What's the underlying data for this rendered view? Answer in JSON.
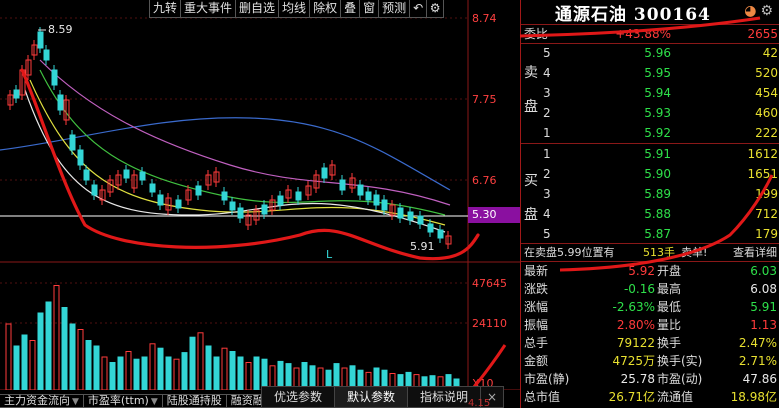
{
  "toolbar": {
    "items": [
      "九转",
      "重大事件",
      "删自选",
      "均线",
      "除权",
      "叠",
      "窗",
      "预测"
    ],
    "back_icon": "back-arrow-icon",
    "settings_icon": "gear-icon"
  },
  "chart": {
    "price_axis": [
      "8.74",
      "7.75",
      "6.76",
      "5.30"
    ],
    "volume_axis": [
      "47645",
      "24110",
      "X10"
    ],
    "high_label": "8.59",
    "low_label": "5.91",
    "low_marker": "L",
    "bottom_price": "4.15"
  },
  "bottom_tabs": [
    {
      "label": "主力资金流向",
      "arrow": "▼"
    },
    {
      "label": "市盈率(ttm)",
      "arrow": "▼"
    },
    {
      "label": "陆股通持股",
      "arrow": ""
    },
    {
      "label": "融资融券余额",
      "arrow": "▼"
    }
  ],
  "footer": {
    "tab_optimize": "优选参数",
    "tab_default": "默认参数",
    "tab_explain": "指标说明",
    "close": "×"
  },
  "quote": {
    "title": "通源石油 300164",
    "committee": {
      "label": "委比",
      "value": "+43.88%",
      "diff": "2655"
    },
    "sell_label": [
      "卖",
      "盘"
    ],
    "buy_label": [
      "买",
      "盘"
    ],
    "sell": [
      {
        "level": "5",
        "price": "5.96",
        "vol": "42"
      },
      {
        "level": "4",
        "price": "5.95",
        "vol": "520"
      },
      {
        "level": "3",
        "price": "5.94",
        "vol": "454"
      },
      {
        "level": "2",
        "price": "5.93",
        "vol": "460"
      },
      {
        "level": "1",
        "price": "5.92",
        "vol": "222"
      }
    ],
    "buy": [
      {
        "level": "1",
        "price": "5.91",
        "vol": "1612"
      },
      {
        "level": "2",
        "price": "5.90",
        "vol": "1651"
      },
      {
        "level": "3",
        "price": "5.89",
        "vol": "199"
      },
      {
        "level": "4",
        "price": "5.88",
        "vol": "712"
      },
      {
        "level": "5",
        "price": "5.87",
        "vol": "179"
      }
    ],
    "instruction": {
      "text": "在卖盘5.99位置有",
      "amount": "513手",
      "action": "卖单!",
      "detail": "查看详细"
    },
    "stats": [
      {
        "l1": "最新",
        "v1": "5.92",
        "c1": "red",
        "l2": "开盘",
        "v2": "6.03",
        "c2": "green"
      },
      {
        "l1": "涨跌",
        "v1": "-0.16",
        "c1": "green",
        "l2": "最高",
        "v2": "6.08",
        "c2": "white"
      },
      {
        "l1": "涨幅",
        "v1": "-2.63%",
        "c1": "green",
        "l2": "最低",
        "v2": "5.91",
        "c2": "green"
      },
      {
        "l1": "振幅",
        "v1": "2.80%",
        "c1": "red",
        "l2": "量比",
        "v2": "1.13",
        "c2": "red"
      },
      {
        "l1": "总手",
        "v1": "79122",
        "c1": "yellow",
        "l2": "换手",
        "v2": "2.47%",
        "c2": "yellow"
      },
      {
        "l1": "金额",
        "v1": "4725万",
        "c1": "yellow",
        "l2": "换手(实)",
        "v2": "2.71%",
        "c2": "yellow"
      },
      {
        "l1": "市盈(静)",
        "v1": "25.78",
        "c1": "white",
        "l2": "市盈(动)",
        "v2": "47.86",
        "c2": "white"
      },
      {
        "l1": "总市值",
        "v1": "26.71亿",
        "c1": "yellow",
        "l2": "流通值",
        "v2": "18.98亿",
        "c2": "yellow"
      }
    ]
  }
}
